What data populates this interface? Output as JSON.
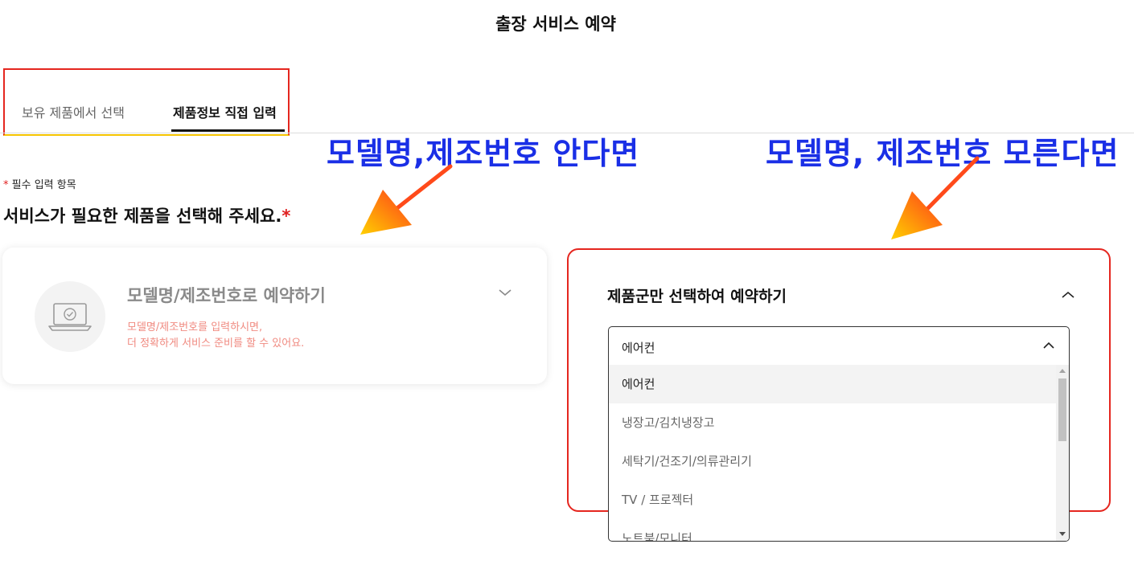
{
  "page": {
    "title": "출장 서비스 예약"
  },
  "tabs": [
    {
      "label": "보유 제품에서 선택",
      "active": false
    },
    {
      "label": "제품정보 직접 입력",
      "active": true
    }
  ],
  "annotations": {
    "left": "모델명,제조번호 안다면",
    "right": "모델명, 제조번호 모른다면"
  },
  "form": {
    "required_star": "*",
    "required_note": "필수 입력 항목",
    "question": "서비스가 필요한 제품을 선택해 주세요.",
    "question_star": "*"
  },
  "card_model": {
    "title": "모델명/제조번호로 예약하기",
    "desc_line1": "모델명/제조번호를 입력하시면,",
    "desc_line2": "더 정확하게 서비스 준비를 할 수 있어요.",
    "icon": "laptop-check-icon",
    "expanded": false
  },
  "card_category": {
    "title": "제품군만 선택하여 예약하기",
    "expanded": true,
    "select": {
      "value": "에어컨",
      "options": [
        "에어컨",
        "냉장고/김치냉장고",
        "세탁기/건조기/의류관리기",
        "TV / 프로젝터",
        "노트북/모니터"
      ],
      "selected_index": 0
    }
  },
  "colors": {
    "highlight_red": "#e5261f",
    "highlight_yellow": "#f5c400",
    "annotation_blue": "#1a2fe6",
    "required_red": "#e02020"
  }
}
